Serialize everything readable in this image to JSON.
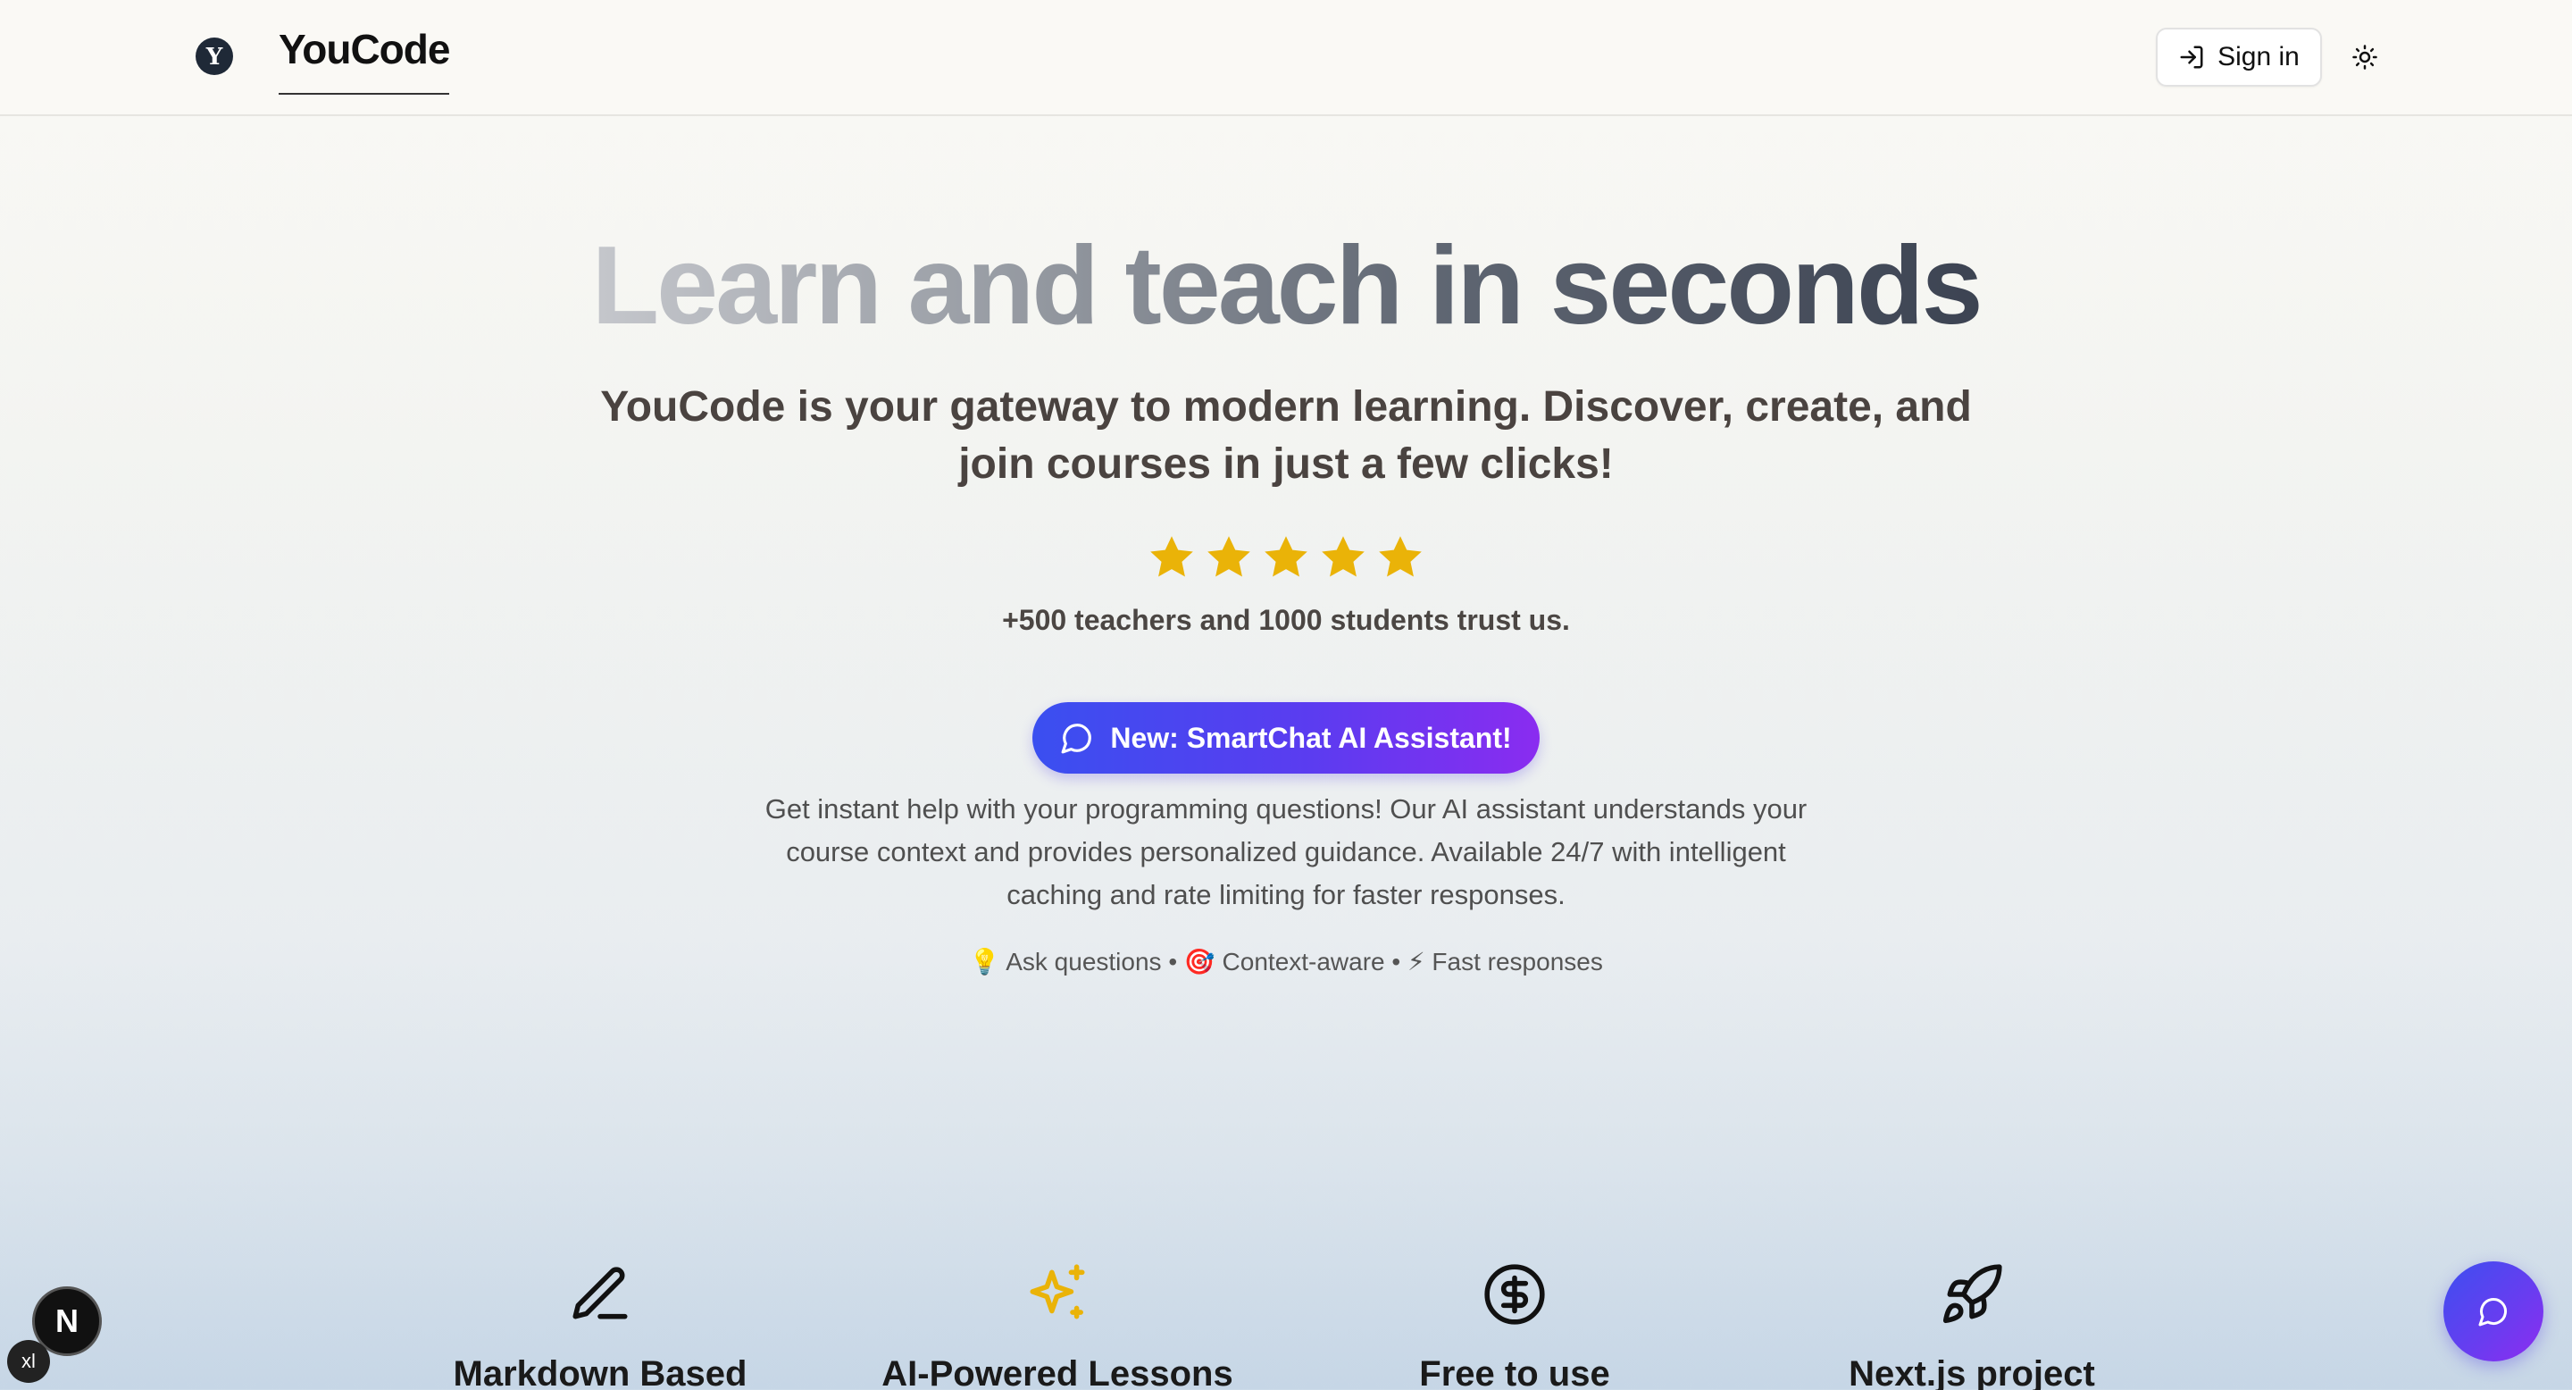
{
  "header": {
    "logo_letter": "Y",
    "brand": "YouCode",
    "signin_label": "Sign in"
  },
  "hero": {
    "title": "Learn and teach in seconds",
    "subtitle": "YouCode is your gateway to modern learning. Discover, create, and join courses in just a few clicks!",
    "rating": 5,
    "rating_max": 5,
    "trust": "+500 teachers and 1000 students trust us.",
    "cta_label": "New: SmartChat AI Assistant!",
    "description": "Get instant help with your programming questions! Our AI assistant understands your course context and provides personalized guidance. Available 24/7 with intelligent caching and rate limiting for faster responses.",
    "features_line": "💡 Ask questions • 🎯 Context-aware • ⚡ Fast responses"
  },
  "features": [
    {
      "label": "Markdown Based",
      "icon": "pencil-icon"
    },
    {
      "label": "AI-Powered Lessons",
      "icon": "sparkles-icon"
    },
    {
      "label": "Free to use",
      "icon": "dollar-circle-icon"
    },
    {
      "label": "Next.js project",
      "icon": "rocket-icon"
    }
  ],
  "floating": {
    "next_badge": "N",
    "size_badge": "xl"
  },
  "colors": {
    "accent_start": "#3a4ff0",
    "accent_end": "#8a2cf0",
    "star": "#eab308",
    "sparkle": "#eab308"
  }
}
